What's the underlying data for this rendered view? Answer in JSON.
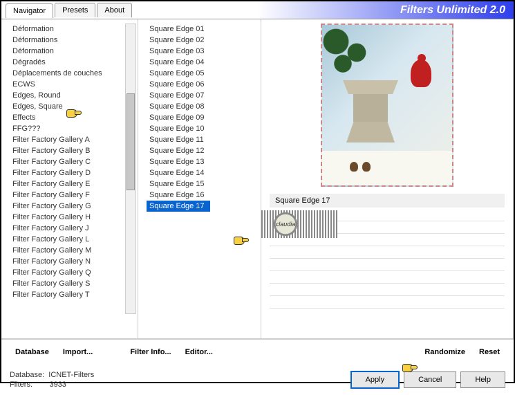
{
  "title": "Filters Unlimited 2.0",
  "tabs": [
    "Navigator",
    "Presets",
    "About"
  ],
  "activeTab": 0,
  "categories": [
    "Déformation",
    "Déformations",
    "Déformation",
    "Dégradés",
    "Déplacements de couches",
    "ECWS",
    "Edges, Round",
    "Edges, Square",
    "Effects",
    "FFG???",
    "Filter Factory Gallery A",
    "Filter Factory Gallery B",
    "Filter Factory Gallery C",
    "Filter Factory Gallery D",
    "Filter Factory Gallery E",
    "Filter Factory Gallery F",
    "Filter Factory Gallery G",
    "Filter Factory Gallery H",
    "Filter Factory Gallery J",
    "Filter Factory Gallery L",
    "Filter Factory Gallery M",
    "Filter Factory Gallery N",
    "Filter Factory Gallery Q",
    "Filter Factory Gallery S",
    "Filter Factory Gallery T"
  ],
  "filters": [
    "Square Edge 01",
    "Square Edge 02",
    "Square Edge 03",
    "Square Edge 04",
    "Square Edge 05",
    "Square Edge 06",
    "Square Edge 07",
    "Square Edge 08",
    "Square Edge 09",
    "Square Edge 10",
    "Square Edge 11",
    "Square Edge 12",
    "Square Edge 13",
    "Square Edge 14",
    "Square Edge 15",
    "Square Edge 16",
    "Square Edge 17"
  ],
  "selectedFilter": 16,
  "previewLabel": "Square Edge 17",
  "badge": "claudia",
  "buttons": {
    "database": "Database",
    "import": "Import...",
    "filterinfo": "Filter Info...",
    "editor": "Editor...",
    "randomize": "Randomize",
    "reset": "Reset",
    "apply": "Apply",
    "cancel": "Cancel",
    "help": "Help"
  },
  "footer": {
    "dbLabel": "Database:",
    "dbVal": "ICNET-Filters",
    "fLabel": "Filters:",
    "fVal": "3933"
  }
}
